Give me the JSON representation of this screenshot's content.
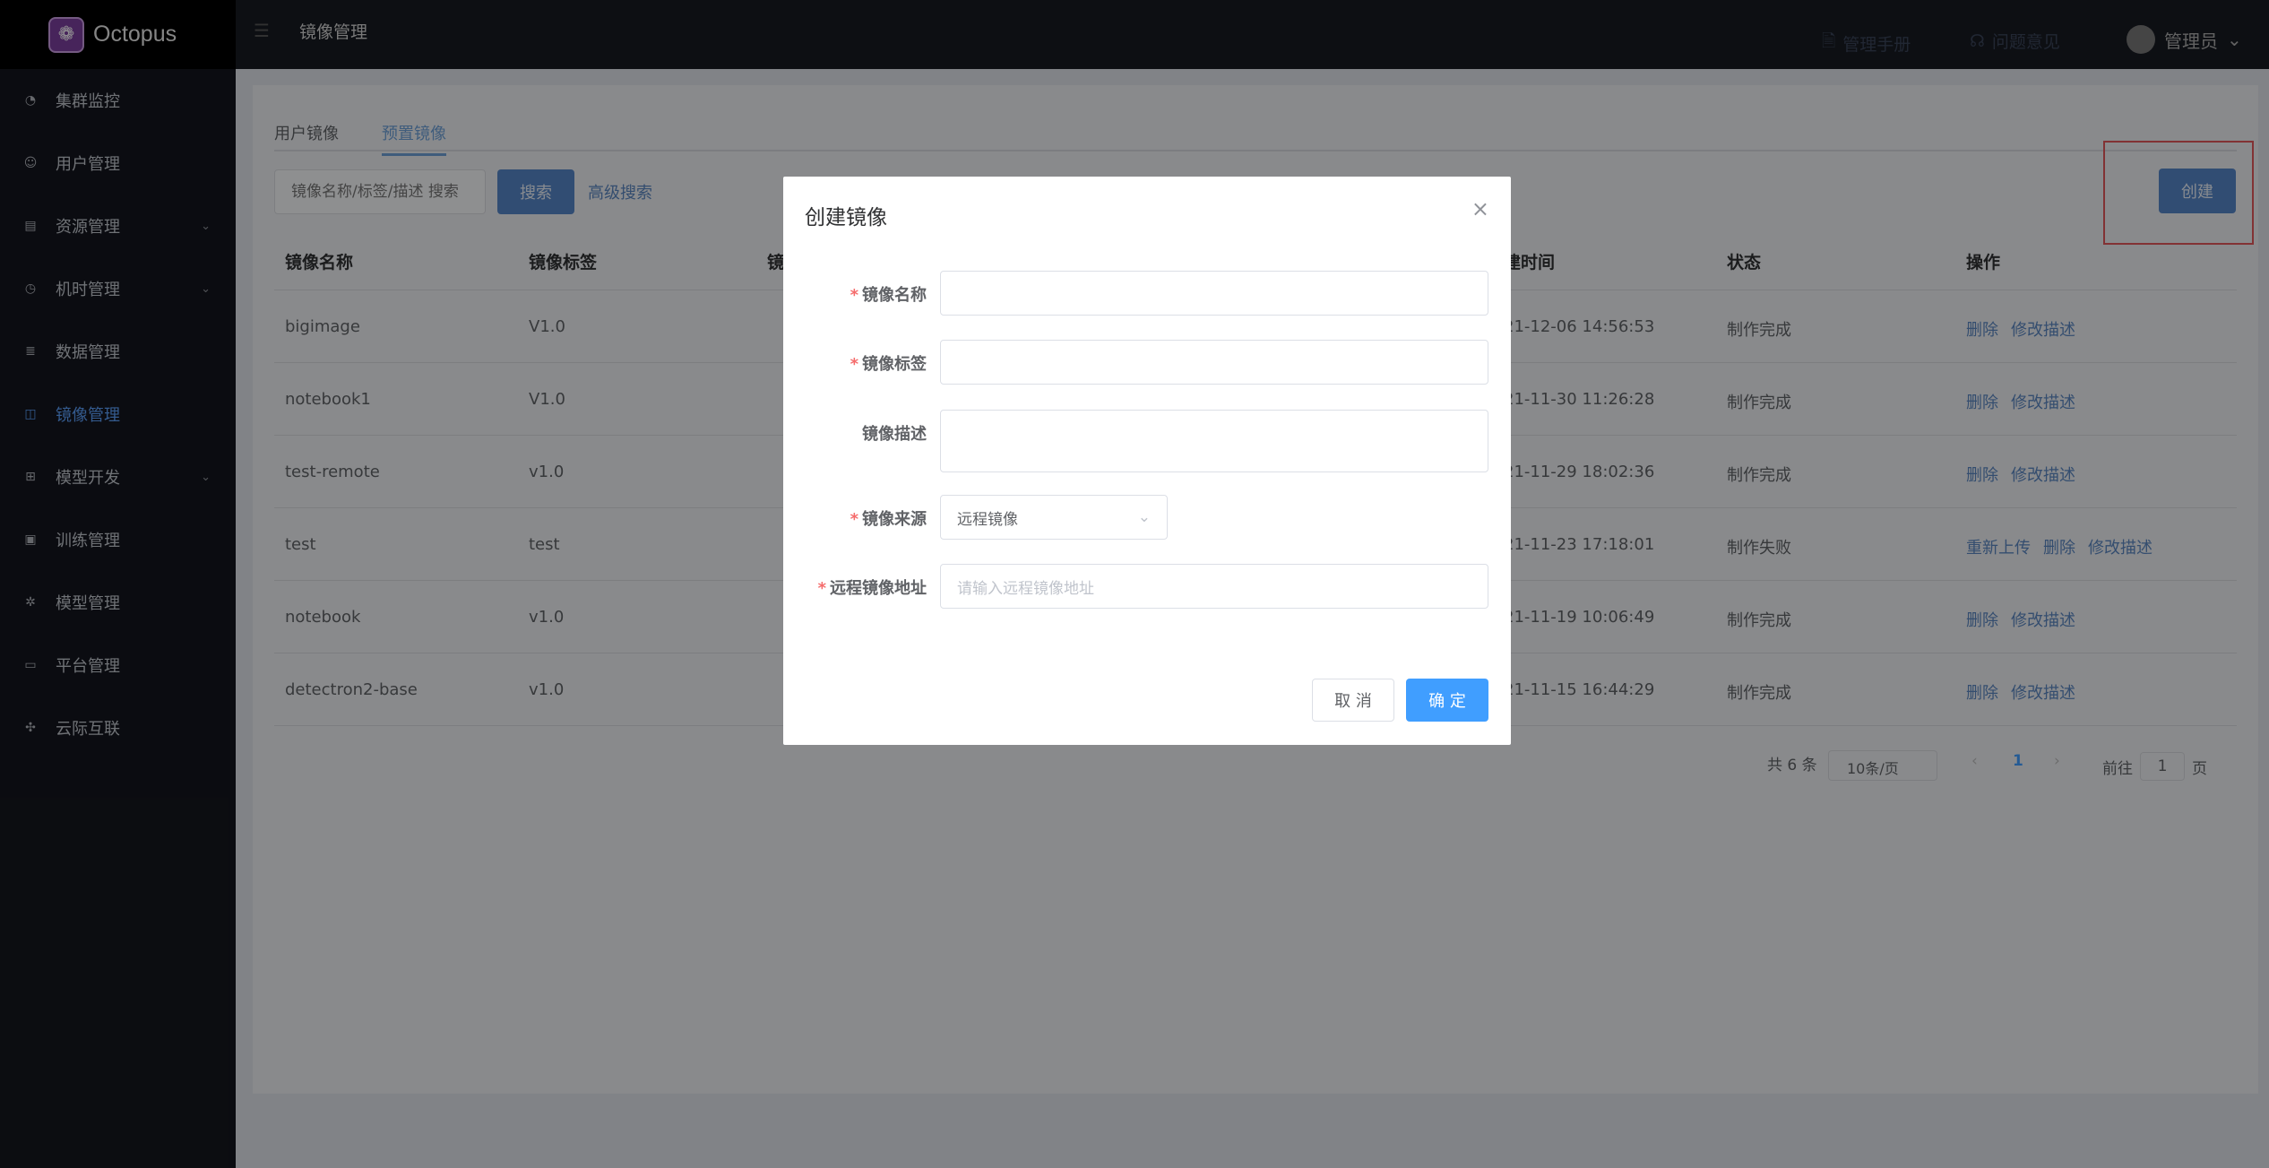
{
  "app": {
    "name": "Octopus"
  },
  "sidebar": {
    "items": [
      {
        "label": "集群监控",
        "icon": "dashboard-icon"
      },
      {
        "label": "用户管理",
        "icon": "user-icon"
      },
      {
        "label": "资源管理",
        "icon": "document-icon",
        "expandable": true
      },
      {
        "label": "机时管理",
        "icon": "clock-icon",
        "expandable": true
      },
      {
        "label": "数据管理",
        "icon": "database-icon"
      },
      {
        "label": "镜像管理",
        "icon": "image-icon",
        "active": true
      },
      {
        "label": "模型开发",
        "icon": "grid-icon",
        "expandable": true
      },
      {
        "label": "训练管理",
        "icon": "file-icon"
      },
      {
        "label": "模型管理",
        "icon": "cog-icon"
      },
      {
        "label": "平台管理",
        "icon": "monitor-icon"
      },
      {
        "label": "云际互联",
        "icon": "network-icon"
      }
    ]
  },
  "header": {
    "title": "镜像管理",
    "manual": "管理手册",
    "feedback": "问题意见",
    "user": "管理员"
  },
  "tabs": [
    {
      "label": "用户镜像",
      "active": false
    },
    {
      "label": "预置镜像",
      "active": true
    }
  ],
  "toolbar": {
    "search_placeholder": "镜像名称/标签/描述 搜索",
    "search_label": "搜索",
    "advanced_label": "高级搜索",
    "create_label": "创建"
  },
  "table": {
    "columns": [
      "镜像名称",
      "镜像标签",
      "镜",
      "建时间",
      "状态",
      "操作"
    ],
    "rows": [
      {
        "name": "bigimage",
        "tag": "V1.0",
        "time": "21-12-06 14:56:53",
        "status": "制作完成",
        "actions": [
          "删除",
          "修改描述"
        ]
      },
      {
        "name": "notebook1",
        "tag": "V1.0",
        "time": "21-11-30 11:26:28",
        "status": "制作完成",
        "actions": [
          "删除",
          "修改描述"
        ]
      },
      {
        "name": "test-remote",
        "tag": "v1.0",
        "time": "21-11-29 18:02:36",
        "status": "制作完成",
        "actions": [
          "删除",
          "修改描述"
        ]
      },
      {
        "name": "test",
        "tag": "test",
        "time": "21-11-23 17:18:01",
        "status": "制作失败",
        "actions": [
          "重新上传",
          "删除",
          "修改描述"
        ]
      },
      {
        "name": "notebook",
        "tag": "v1.0",
        "time": "21-11-19 10:06:49",
        "status": "制作完成",
        "actions": [
          "删除",
          "修改描述"
        ]
      },
      {
        "name": "detectron2-base",
        "tag": "v1.0",
        "time": "21-11-15 16:44:29",
        "status": "制作完成",
        "actions": [
          "删除",
          "修改描述"
        ]
      }
    ]
  },
  "pagination": {
    "total": "共 6 条",
    "page_size": "10条/页",
    "current_page": "1",
    "goto_prefix": "前往",
    "goto_value": "1",
    "goto_suffix": "页"
  },
  "dialog": {
    "title": "创建镜像",
    "fields": {
      "name_label": "镜像名称",
      "tag_label": "镜像标签",
      "desc_label": "镜像描述",
      "source_label": "镜像来源",
      "source_value": "远程镜像",
      "remote_label": "远程镜像地址",
      "remote_placeholder": "请输入远程镜像地址"
    },
    "cancel_label": "取 消",
    "ok_label": "确 定"
  },
  "colors": {
    "primary": "#409eff",
    "danger": "#f56c6c",
    "highlight_box": "#e0575b"
  }
}
